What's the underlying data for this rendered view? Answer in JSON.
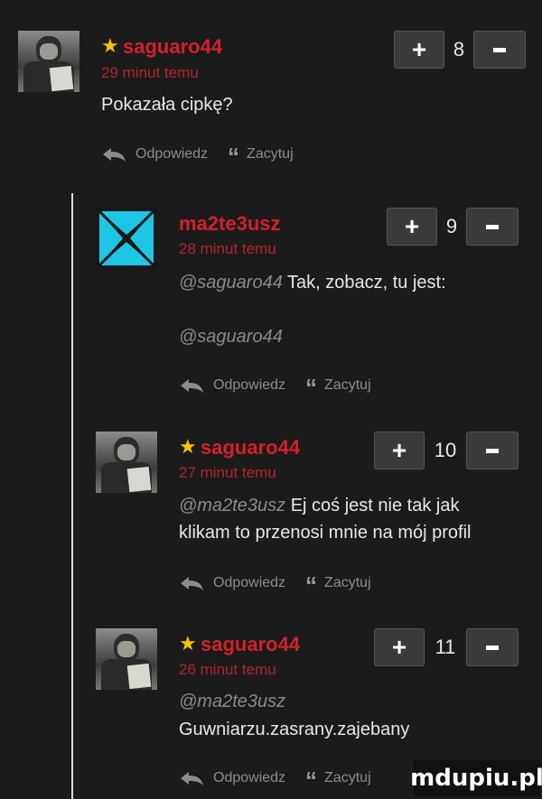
{
  "comments": [
    {
      "username": "saguaro44",
      "has_star": true,
      "time": "29 minut temu",
      "mention": "",
      "text": "Pokazała cipkę?",
      "score": "8",
      "reply_label": "Odpowiedz",
      "quote_label": "Zacytuj"
    },
    {
      "username": "ma2te3usz",
      "has_star": false,
      "time": "28 minut temu",
      "mention": "@saguaro44",
      "text": "Tak, zobacz, tu jest:",
      "mention2": "@saguaro44",
      "score": "9",
      "reply_label": "Odpowiedz",
      "quote_label": "Zacytuj"
    },
    {
      "username": "saguaro44",
      "has_star": true,
      "time": "27 minut temu",
      "mention": "@ma2te3usz",
      "text_line1": "Ej coś jest nie tak jak",
      "text_line2": "klikam to przenosi mnie na mój profil",
      "score": "10",
      "reply_label": "Odpowiedz",
      "quote_label": "Zacytuj"
    },
    {
      "username": "saguaro44",
      "has_star": true,
      "time": "26 minut temu",
      "mention": "@ma2te3usz",
      "text": "Guwniarzu.zasrany.zajebany",
      "score": "11",
      "reply_label": "Odpowiedz",
      "quote_label": "Zacytuj"
    }
  ],
  "vote": {
    "plus": "+",
    "minus": "−"
  },
  "watermark": "mdupiu.pl",
  "colors": {
    "username": "#d3202a",
    "time": "#b0242c",
    "star": "#f4c400",
    "background": "#1b1b1b"
  }
}
